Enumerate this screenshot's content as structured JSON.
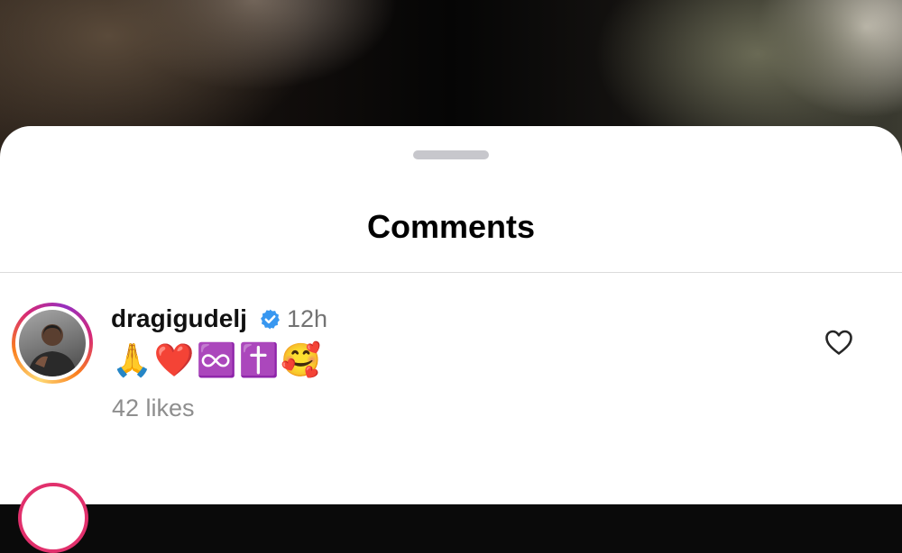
{
  "sheet": {
    "title": "Comments"
  },
  "comments": [
    {
      "username": "dragigudelj",
      "verified": true,
      "time": "12h",
      "text": "🙏❤️♾️✝️🥰",
      "likes": "42 likes"
    }
  ],
  "colors": {
    "verified_badge": "#3897f0",
    "muted_text": "#737373",
    "divider": "#dbdbdb",
    "story_ring": "#d62976"
  },
  "icons": {
    "verified": "verified-badge-icon",
    "like": "heart-outline-icon"
  }
}
